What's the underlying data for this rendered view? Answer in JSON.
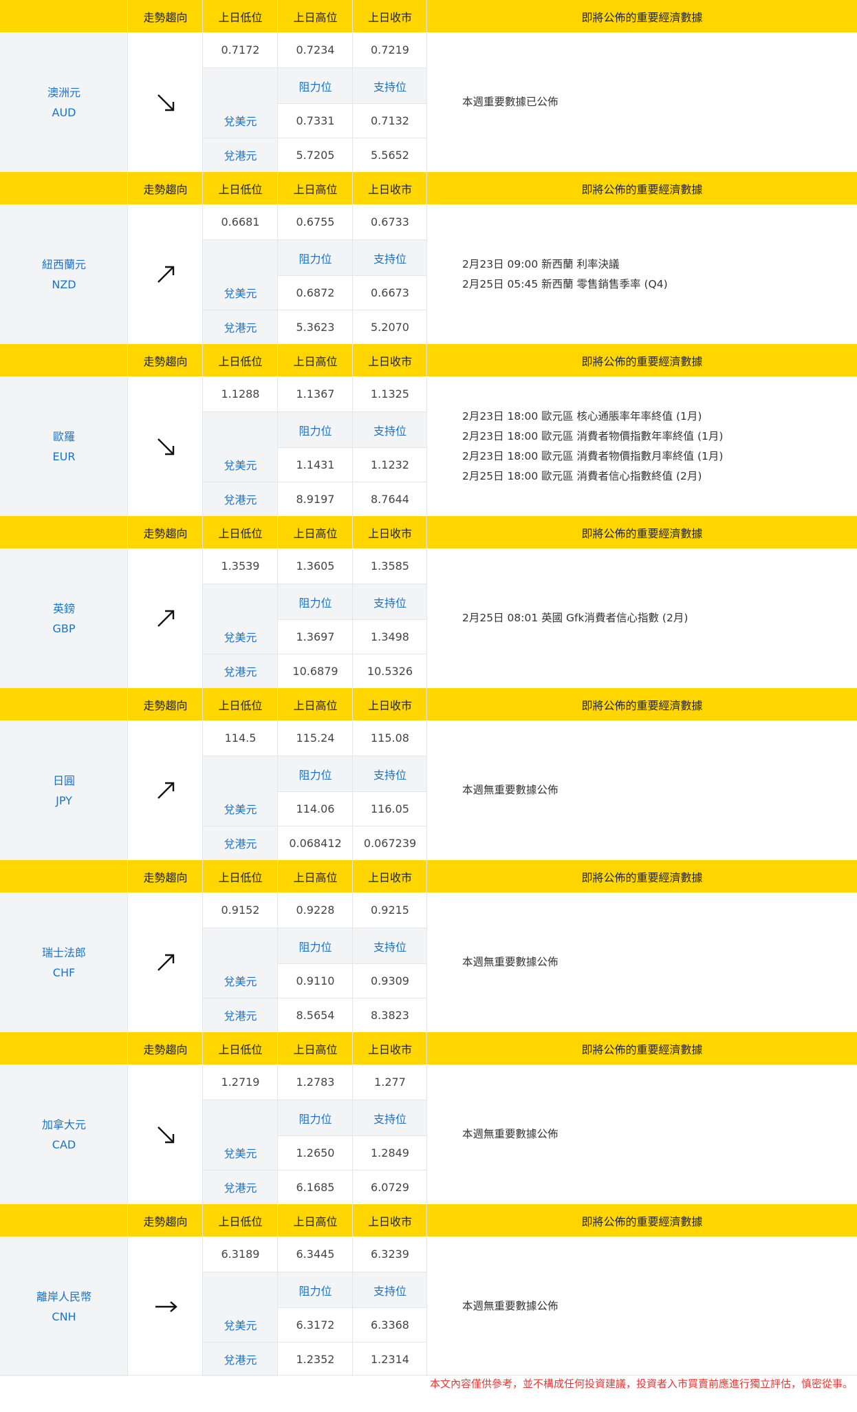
{
  "headers": {
    "trend": "走勢趨向",
    "low": "上日低位",
    "high": "上日高位",
    "close": "上日收市",
    "data": "即將公佈的重要經濟數據"
  },
  "labels": {
    "resistance": "阻力位",
    "support": "支持位",
    "usd": "兌美元",
    "hkd": "兌港元"
  },
  "currencies": [
    {
      "name_zh": "澳洲元",
      "code": "AUD",
      "trend": "down",
      "low": "0.7172",
      "high": "0.7234",
      "close": "0.7219",
      "usd_res": "0.7331",
      "usd_sup": "0.7132",
      "hkd_res": "5.7205",
      "hkd_sup": "5.5652",
      "events": [
        "本週重要數據已公佈"
      ]
    },
    {
      "name_zh": "紐西蘭元",
      "code": "NZD",
      "trend": "up",
      "low": "0.6681",
      "high": "0.6755",
      "close": "0.6733",
      "usd_res": "0.6872",
      "usd_sup": "0.6673",
      "hkd_res": "5.3623",
      "hkd_sup": "5.2070",
      "events": [
        "2月23日 09:00  新西蘭 利率決議",
        "2月25日 05:45  新西蘭 零售銷售季率 (Q4)"
      ]
    },
    {
      "name_zh": "歐羅",
      "code": "EUR",
      "trend": "down",
      "low": "1.1288",
      "high": "1.1367",
      "close": "1.1325",
      "usd_res": "1.1431",
      "usd_sup": "1.1232",
      "hkd_res": "8.9197",
      "hkd_sup": "8.7644",
      "events": [
        "2月23日 18:00  歐元區 核心通脹率年率終值 (1月)",
        "2月23日 18:00  歐元區 消費者物價指數年率終值 (1月)",
        "2月23日 18:00  歐元區 消費者物價指數月率終值 (1月)",
        "2月25日 18:00  歐元區 消費者信心指數終值 (2月)"
      ]
    },
    {
      "name_zh": "英鎊",
      "code": "GBP",
      "trend": "up",
      "low": "1.3539",
      "high": "1.3605",
      "close": "1.3585",
      "usd_res": "1.3697",
      "usd_sup": "1.3498",
      "hkd_res": "10.6879",
      "hkd_sup": "10.5326",
      "events": [
        "2月25日 08:01  英國 Gfk消費者信心指數 (2月)"
      ]
    },
    {
      "name_zh": "日圓",
      "code": "JPY",
      "trend": "up",
      "low": "114.5",
      "high": "115.24",
      "close": "115.08",
      "usd_res": "114.06",
      "usd_sup": "116.05",
      "hkd_res": "0.068412",
      "hkd_sup": "0.067239",
      "events": [
        "本週無重要數據公佈"
      ]
    },
    {
      "name_zh": "瑞士法郎",
      "code": "CHF",
      "trend": "up",
      "low": "0.9152",
      "high": "0.9228",
      "close": "0.9215",
      "usd_res": "0.9110",
      "usd_sup": "0.9309",
      "hkd_res": "8.5654",
      "hkd_sup": "8.3823",
      "events": [
        "本週無重要數據公佈"
      ]
    },
    {
      "name_zh": "加拿大元",
      "code": "CAD",
      "trend": "down",
      "low": "1.2719",
      "high": "1.2783",
      "close": "1.277",
      "usd_res": "1.2650",
      "usd_sup": "1.2849",
      "hkd_res": "6.1685",
      "hkd_sup": "6.0729",
      "events": [
        "本週無重要數據公佈"
      ]
    },
    {
      "name_zh": "離岸人民幣",
      "code": "CNH",
      "trend": "flat",
      "low": "6.3189",
      "high": "6.3445",
      "close": "6.3239",
      "usd_res": "6.3172",
      "usd_sup": "6.3368",
      "hkd_res": "1.2352",
      "hkd_sup": "1.2314",
      "events": [
        "本週無重要數據公佈"
      ]
    }
  ],
  "icons": {
    "down": "arrow-down-right-icon",
    "up": "arrow-up-right-icon",
    "flat": "arrow-right-icon"
  },
  "colors": {
    "header": "#FFD600",
    "accent": "#1a73c8",
    "disclaimer": "#e53935",
    "shade": "#F3F4F6"
  },
  "disclaimer": "本文內容僅供參考，並不構成任何投資建議，投資者入市買賣前應進行獨立評估，慎密從事。"
}
